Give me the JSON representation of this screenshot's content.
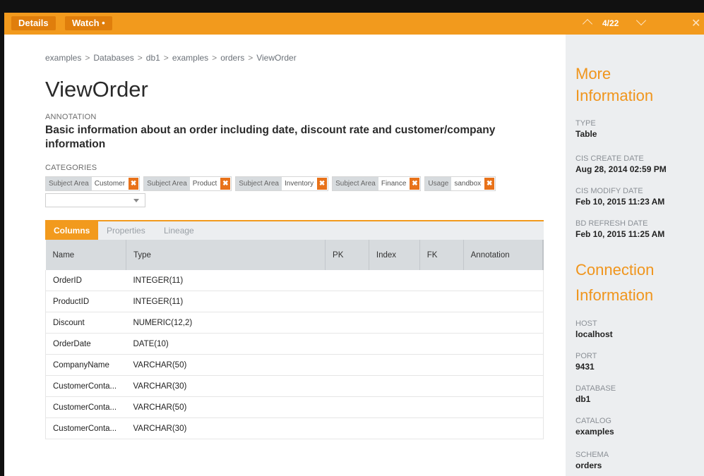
{
  "topbar": {
    "details_label": "Details",
    "watch_label": "Watch •",
    "position": "4/22",
    "close_glyph": "✕"
  },
  "breadcrumb": [
    "examples",
    "Databases",
    "db1",
    "examples",
    "orders",
    "ViewOrder"
  ],
  "breadcrumb_separator": ">",
  "title": "ViewOrder",
  "annotation": {
    "label": "ANNOTATION",
    "text": "Basic information about an order including date, discount rate and customer/company information"
  },
  "categories": {
    "label": "CATEGORIES",
    "tags": [
      {
        "key": "Subject Area",
        "value": "Customer"
      },
      {
        "key": "Subject Area",
        "value": "Product"
      },
      {
        "key": "Subject Area",
        "value": "Inventory"
      },
      {
        "key": "Subject Area",
        "value": "Finance"
      },
      {
        "key": "Usage",
        "value": "sandbox"
      }
    ],
    "remove_glyph": "✖",
    "select_value": ""
  },
  "tabs": [
    "Columns",
    "Properties",
    "Lineage"
  ],
  "table": {
    "headers": [
      "Name",
      "Type",
      "PK",
      "Index",
      "FK",
      "Annotation"
    ],
    "rows": [
      [
        "OrderID",
        "INTEGER(11)",
        "",
        "",
        "",
        ""
      ],
      [
        "ProductID",
        "INTEGER(11)",
        "",
        "",
        "",
        ""
      ],
      [
        "Discount",
        "NUMERIC(12,2)",
        "",
        "",
        "",
        ""
      ],
      [
        "OrderDate",
        "DATE(10)",
        "",
        "",
        "",
        ""
      ],
      [
        "CompanyName",
        "VARCHAR(50)",
        "",
        "",
        "",
        ""
      ],
      [
        "CustomerConta...",
        "VARCHAR(30)",
        "",
        "",
        "",
        ""
      ],
      [
        "CustomerConta...",
        "VARCHAR(50)",
        "",
        "",
        "",
        ""
      ],
      [
        "CustomerConta...",
        "VARCHAR(30)",
        "",
        "",
        "",
        ""
      ]
    ]
  },
  "sidebar": {
    "more_info_title_1": "More",
    "more_info_title_2": "Information",
    "type_label": "TYPE",
    "type_value": "Table",
    "cis_create_label": "CIS CREATE DATE",
    "cis_create_value": "Aug 28, 2014 02:59 PM",
    "cis_modify_label": "CIS MODIFY DATE",
    "cis_modify_value": "Feb 10, 2015 11:23 AM",
    "bd_refresh_label": "BD REFRESH DATE",
    "bd_refresh_value": "Feb 10, 2015 11:25 AM",
    "conn_title_1": "Connection",
    "conn_title_2": "Information",
    "host_label": "HOST",
    "host_value": "localhost",
    "port_label": "PORT",
    "port_value": "9431",
    "database_label": "DATABASE",
    "database_value": "db1",
    "catalog_label": "CATALOG",
    "catalog_value": "examples",
    "schema_label": "SCHEMA",
    "schema_value": "orders"
  },
  "colors": {
    "accent": "#f29a1d",
    "tag_remove": "#e8721a",
    "sidebar_bg": "#eceef0",
    "header_bg": "#d7dbde"
  }
}
